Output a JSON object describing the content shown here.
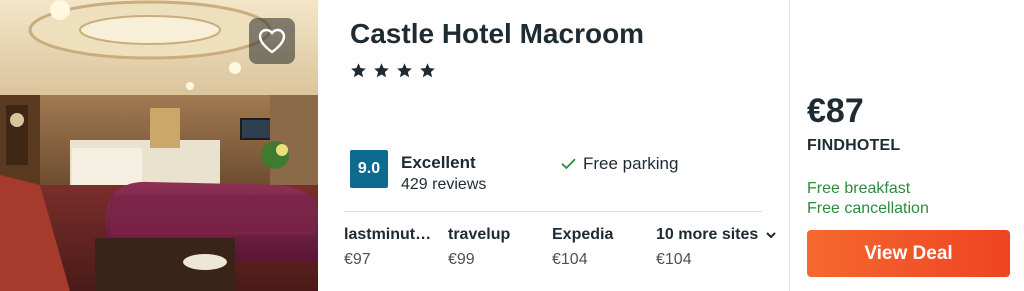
{
  "hotel": {
    "name": "Castle Hotel Macroom",
    "star_rating": 4,
    "favorite_icon": "heart-outline-icon"
  },
  "rating": {
    "score": "9.0",
    "label": "Excellent",
    "reviews": "429 reviews",
    "badge_color": "#0c6b8f"
  },
  "amenities": [
    {
      "label": "Free parking",
      "icon": "check-icon"
    }
  ],
  "other_sites": [
    {
      "name": "lastminut…",
      "price": "€97"
    },
    {
      "name": "travelup",
      "price": "€99"
    },
    {
      "name": "Expedia",
      "price": "€104"
    },
    {
      "name": "10 more sites",
      "price": "€104",
      "icon": "chevron-down-icon"
    }
  ],
  "deal": {
    "price": "€87",
    "provider": "FINDHOTEL",
    "perks": [
      "Free breakfast",
      "Free cancellation"
    ],
    "perk_color": "#2f8a3b",
    "button_label": "View Deal",
    "button_colors": [
      "#f5692f",
      "#ef4322"
    ]
  }
}
